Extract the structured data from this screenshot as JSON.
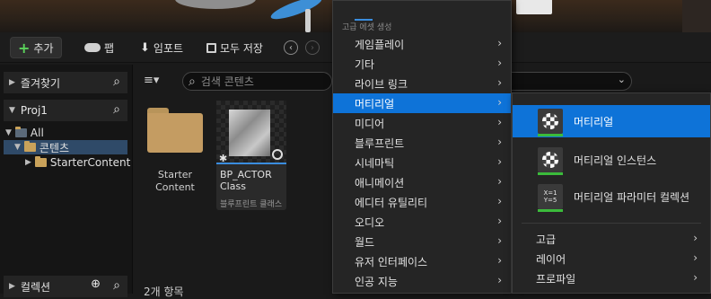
{
  "toolbar": {
    "add_label": "추가",
    "fab_label": "팹",
    "import_label": "임포트",
    "save_all_label": "모두 저장"
  },
  "sidebar": {
    "favorites_label": "즐겨찾기",
    "project_label": "Proj1",
    "tree": [
      "All",
      "콘텐츠",
      "StarterContent"
    ],
    "collections_label": "컬렉션"
  },
  "content": {
    "search_placeholder": "검색 콘텐츠",
    "items": [
      {
        "name_line1": "Starter",
        "name_line2": "Content"
      },
      {
        "name_line1": "BP_ACTOR",
        "name_line2": "Class",
        "type_label": "블루프린트 클래스"
      }
    ],
    "item_count": "2개 항목"
  },
  "menu": {
    "section_label": "고급 에셋 생성",
    "items": [
      "게임플레이",
      "기타",
      "라이브 링크",
      "머티리얼",
      "미디어",
      "블루프린트",
      "시네마틱",
      "애니메이션",
      "에디터 유틸리티",
      "오디오",
      "월드",
      "유저 인터페이스",
      "인공 지능"
    ],
    "selected_index": 3
  },
  "submenu": {
    "items": [
      "머티리얼",
      "머티리얼 인스턴스",
      "머티리얼 파라미터 컬렉션"
    ],
    "param_icon_lines": [
      "X=1",
      "Y=5"
    ],
    "sub_items": [
      "고급",
      "레이어",
      "프로파일"
    ],
    "selected_index": 0
  },
  "colors": {
    "accent": "#0e73d8",
    "menu_bg": "#252525",
    "green": "#3bbb3b"
  }
}
